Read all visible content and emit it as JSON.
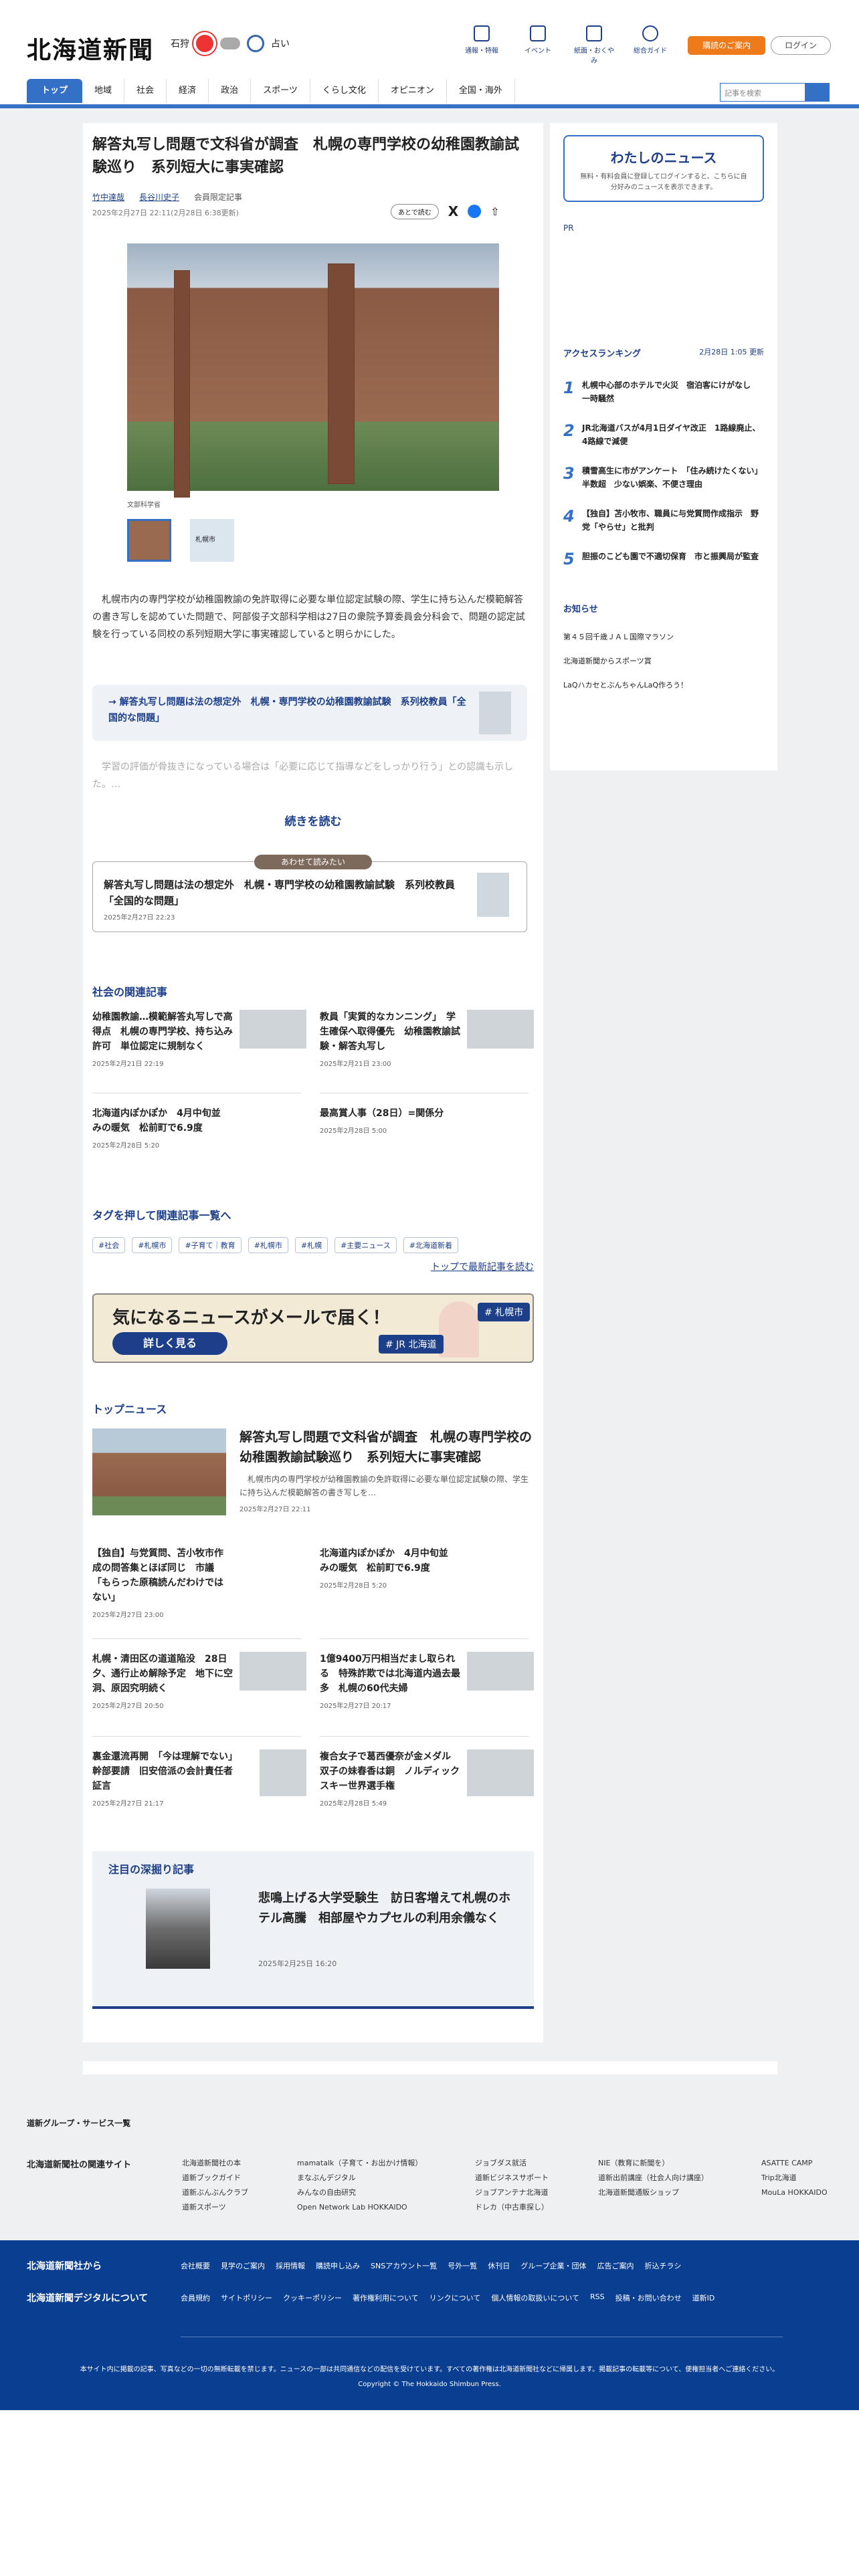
{
  "header": {
    "logo": "北海道新聞",
    "city": "石狩",
    "fortune": "占い",
    "icons": [
      "通報・特報",
      "イベント",
      "紙面・おくやみ",
      "総合ガイド"
    ],
    "subscribe": "購読のご案内",
    "login": "ログイン",
    "search_placeholder": "記事を検索"
  },
  "nav": [
    "トップ",
    "地域",
    "社会",
    "経済",
    "政治",
    "スポーツ",
    "くらし文化",
    "オピニオン",
    "全国・海外"
  ],
  "article": {
    "title": "解答丸写し問題で文科省が調査　札幌の専門学校の幼稚園教諭試験巡り　系列短大に事実確認",
    "author1": "竹中達哉",
    "author2": "長谷川史子",
    "members": "会員限定記事",
    "date": "2025年2月27日 22:11(2月28日 6:38更新)",
    "later": "あとで読む",
    "caption": "文部科学省",
    "thumb2": "札幌市",
    "lead": "　札幌市内の専門学校が幼稚園教諭の免許取得に必要な単位認定試験の際、学生に持ち込んだ模範解答の書き写しを認めていた問題で、阿部俊子文部科学相は27日の衆院予算委員会分科会で、問題の認定試験を行っている同校の系列短期大学に事実確認していると明らかにした。",
    "related": "→ 解答丸写し問題は法の想定外　札幌・専門学校の幼稚園教諭試験　系列校教員「全国的な問題」",
    "fade": "　学習の評価が骨抜きになっている場合は「必要に応じて指導などをしっかり行う」との認識も示した。…",
    "more": "続きを読む",
    "tag": "あわせて読みたい",
    "rbox_title": "解答丸写し問題は法の想定外　札幌・専門学校の幼稚園教諭試験　系列校教員「全国的な問題」",
    "rbox_date": "2025年2月27日 22:23"
  },
  "social": {
    "head": "社会の関連記事",
    "items": [
      {
        "t": "幼稚園教諭…模範解答丸写しで高得点　札幌の専門学校、持ち込み許可　単位認定に規制なく",
        "d": "2025年2月21日 22:19"
      },
      {
        "t": "教員「実質的なカンニング」　学生確保へ取得優先　幼稚園教諭試験・解答丸写し",
        "d": "2025年2月21日 23:00"
      },
      {
        "t": "北海道内ぽかぽか　4月中旬並みの暖気　松前町で6.9度",
        "d": "2025年2月28日 5:20"
      },
      {
        "t": "最高賞人事（28日）=関係分",
        "d": "2025年2月28日 5:00"
      }
    ]
  },
  "tagsection": {
    "head": "タグを押して関連記事一覧へ",
    "tags": [
      "#社会",
      "#札幌市",
      "#子育て｜教育",
      "#札幌市",
      "#札幌",
      "#主要ニュース",
      "#北海道新着"
    ],
    "latest": "トップで最新記事を読む"
  },
  "banner": {
    "head": "気になるニュースがメールで届く！",
    "btn": "詳しく見る",
    "t1": "# JR 北海道",
    "t2": "# 札幌市"
  },
  "topnews": {
    "head": "トップニュース",
    "main_title": "解答丸写し問題で文科省が調査　札幌の専門学校の幼稚園教諭試験巡り　系列短大に事実確認",
    "main_snip": "　札幌市内の専門学校が幼稚園教諭の免許取得に必要な単位認定試験の際、学生に持ち込んだ模範解答の書き写しを…",
    "main_date": "2025年2月27日 22:11",
    "items": [
      {
        "t": "【独自】与党質問、苫小牧市作成の問答集とほぼ同じ　市議「もらった原稿読んだわけではない」",
        "d": "2025年2月27日 23:00"
      },
      {
        "t": "北海道内ぽかぽか　4月中旬並みの暖気　松前町で6.9度",
        "d": "2025年2月28日 5:20"
      },
      {
        "t": "札幌・清田区の道道陥没　28日夕、通行止め解除予定　地下に空洞、原因究明続く",
        "d": "2025年2月27日 20:50"
      },
      {
        "t": "1億9400万円相当だまし取られる　特殊詐欺では北海道内過去最多　札幌の60代夫婦",
        "d": "2025年2月27日 20:17"
      },
      {
        "t": "裏金還流再開　「今は理解でない」幹部要請　旧安倍派の会計責任者証言",
        "d": "2025年2月27日 21:17"
      },
      {
        "t": "複合女子で葛西優奈が金メダル　双子の妹春香は銅　ノルディックスキー世界選手権",
        "d": "2025年2月28日 5:49"
      }
    ]
  },
  "deep": {
    "head": "注目の深掘り記事",
    "title": "悲鳴上げる大学受験生　訪日客増えて札幌のホテル高騰　相部屋やカプセルの利用余儀なく",
    "date": "2025年2月25日 16:20"
  },
  "sidebar": {
    "mynews": "わたしのニュース",
    "mynews_p": "無料・有料会員に登録してログインすると、こちらに自分好みのニュースを表示できます。",
    "pr": "PR",
    "rank_head": "アクセスランキング",
    "rank_date": "2月28日 1:05 更新",
    "rank": [
      "札幌中心部のホテルで火災　宿泊客にけがなし　一時騒然",
      "JR北海道バスが4月1日ダイヤ改正　1路線廃止、4路線で減便",
      "積雪高生に市がアンケート　「住み続けたくない」半数超　少ない娯楽、不便さ理由",
      "【独自】苫小牧市、職員に与党質問作成指示　野党「やらせ」と批判",
      "胆振のこども園で不適切保育　市と振興局が監査"
    ],
    "notice_head": "お知らせ",
    "notices": [
      "第４５回千歳ＪＡＬ国際マラソン",
      "北海道新聞からスポーツ賞",
      "LaQハカセとぶんちゃんLaQ作ろう！"
    ]
  },
  "footer": {
    "group": "道新グループ・サービス一覧",
    "sites": "北海道新聞社の関連サイト",
    "cols": [
      [
        "北海道新聞社の本",
        "道新ブックガイド",
        "道新ぶんぶんクラブ",
        "道新スポーツ"
      ],
      [
        "mamatalk（子育て・お出かけ情報）",
        "まなぶんデジタル",
        "みんなの自由研究",
        "Open Network Lab HOKKAIDO"
      ],
      [
        "ジョブダス就活",
        "道新ビジネスサポート",
        "ジョブアンテナ北海道",
        "ドレカ（中古車探し）"
      ],
      [
        "NIE（教育に新聞を）",
        "道新出前講座（社会人向け講座）",
        "北海道新聞通販ショップ"
      ],
      [
        "ASATTE CAMP",
        "Trip北海道",
        "MouLa HOKKAIDO"
      ]
    ],
    "blue1": "北海道新聞社から",
    "blue2": "北海道新聞デジタルについて",
    "links1": [
      "会社概要",
      "見学のご案内",
      "採用情報",
      "購読申し込み",
      "SNSアカウント一覧",
      "号外一覧",
      "休刊日",
      "グループ企業・団体",
      "広告ご案内",
      "折込チラシ"
    ],
    "links2": [
      "会員規約",
      "サイトポリシー",
      "クッキーポリシー",
      "著作権利用について",
      "リンクについて",
      "個人情報の取扱いについて",
      "RSS",
      "投稿・お問い合わせ",
      "道新ID"
    ],
    "note": "本サイト内に掲載の記事、写真などの一切の無断転載を禁じます。ニュースの一部は共同通信などの配信を受けています。すべての著作権は北海道新聞社などに帰属します。掲載記事の転載等について、便権担当者へご連絡ください。",
    "copy": "Copyright © The Hokkaido Shimbun Press."
  }
}
